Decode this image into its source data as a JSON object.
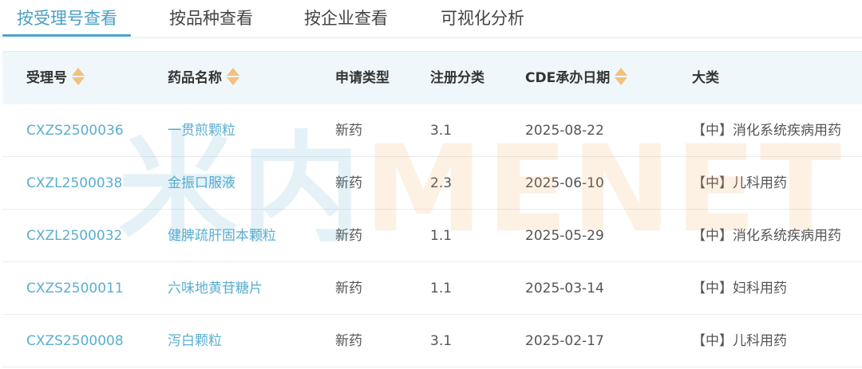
{
  "tabs": [
    {
      "label": "按受理号查看",
      "active": true
    },
    {
      "label": "按品种查看",
      "active": false
    },
    {
      "label": "按企业查看",
      "active": false
    },
    {
      "label": "可视化分析",
      "active": false
    }
  ],
  "table": {
    "columns": [
      {
        "label": "受理号",
        "sortable": true
      },
      {
        "label": "药品名称",
        "sortable": true
      },
      {
        "label": "申请类型",
        "sortable": false
      },
      {
        "label": "注册分类",
        "sortable": false
      },
      {
        "label": "CDE承办日期",
        "sortable": true
      },
      {
        "label": "大类",
        "sortable": false
      }
    ],
    "rows": [
      [
        "CXZS2500036",
        "一贯煎颗粒",
        "新药",
        "3.1",
        "2025-08-22",
        "【中】消化系统疾病用药"
      ],
      [
        "CXZL2500038",
        "金振口服液",
        "新药",
        "2.3",
        "2025-06-10",
        "【中】儿科用药"
      ],
      [
        "CXZL2500032",
        "健脾疏肝固本颗粒",
        "新药",
        "1.1",
        "2025-05-29",
        "【中】消化系统疾病用药"
      ],
      [
        "CXZS2500011",
        "六味地黄苷糖片",
        "新药",
        "1.1",
        "2025-03-14",
        "【中】妇科用药"
      ],
      [
        "CXZS2500008",
        "泻白颗粒",
        "新药",
        "3.1",
        "2025-02-17",
        "【中】儿科用药"
      ]
    ]
  },
  "watermark": {
    "part_a": "米内",
    "part_b": "MENET"
  },
  "colors": {
    "accent": "#4a9ec4",
    "link": "#5aaed0",
    "header_bg": "#eff7fa",
    "sort_icon": "#f3c07f"
  },
  "icons": {
    "sort": "sort-caret-icon"
  }
}
